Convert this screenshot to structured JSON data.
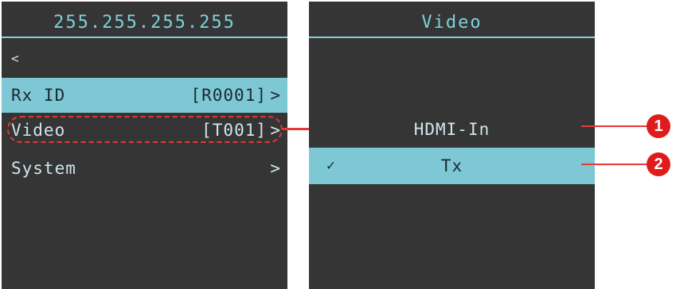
{
  "left_panel": {
    "header": "255.255.255.255",
    "back": "<",
    "rows": [
      {
        "label": "Rx ID",
        "value": "[R0001]",
        "chevron": ">",
        "selected": true
      },
      {
        "label": "Video",
        "value": "[T001]",
        "chevron": ">",
        "selected": false
      },
      {
        "label": "System",
        "value": "",
        "chevron": ">",
        "selected": false
      }
    ]
  },
  "right_panel": {
    "header": "Video",
    "options": [
      {
        "label": "HDMI-In",
        "checked": false,
        "check": ""
      },
      {
        "label": "Tx",
        "checked": true,
        "check": "✓"
      }
    ]
  },
  "callouts": [
    "1",
    "2"
  ],
  "colors": {
    "panel_bg": "#353535",
    "accent": "#7fd1dd",
    "selected_bg": "#7ec8d5",
    "annotation_red": "#e53935"
  }
}
